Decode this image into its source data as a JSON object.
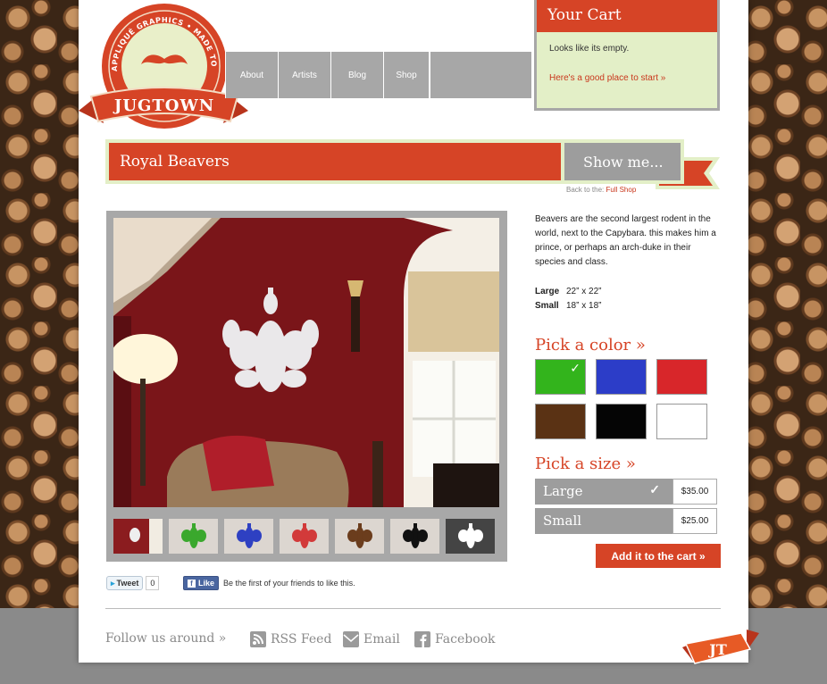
{
  "logo": {
    "arc_text": "VINYL APPLIQUÉ GRAPHICS • MADE TO ORDER",
    "brand": "JUGTOWN"
  },
  "nav": {
    "items": [
      "About",
      "Artists",
      "Blog",
      "Shop"
    ]
  },
  "cart": {
    "title": "Your Cart",
    "empty_text": "Looks like its empty.",
    "start_link": "Here's a good place to start »"
  },
  "product": {
    "title": "Royal Beavers",
    "show_me": "Show me...",
    "back_prefix": "Back to the:",
    "back_link": "Full Shop",
    "description": "Beavers are the second largest rodent in the world, next to the Capybara. this makes him a prince, or perhaps an arch-duke in their species and class.",
    "sizes": [
      {
        "label": "Large",
        "dims": "22” x 22”"
      },
      {
        "label": "Small",
        "dims": "18” x 18”"
      }
    ]
  },
  "thumbnails": {
    "colors": [
      "#ffffff",
      "#3aa82d",
      "#2e40c2",
      "#d23a3a",
      "#6b3d1d",
      "#111111",
      "#ffffff"
    ],
    "backgrounds": [
      "#8b1c1f",
      "#dcd6d0",
      "#dcd6d0",
      "#dcd6d0",
      "#dcd6d0",
      "#dcd6d0",
      "#444444"
    ]
  },
  "color_picker": {
    "heading": "Pick a color »",
    "swatches": [
      {
        "name": "green",
        "hex": "#33b41c",
        "selected": true
      },
      {
        "name": "blue",
        "hex": "#2c3dc8",
        "selected": false
      },
      {
        "name": "red",
        "hex": "#d8262a",
        "selected": false
      },
      {
        "name": "brown",
        "hex": "#5a3214",
        "selected": false
      },
      {
        "name": "black",
        "hex": "#050505",
        "selected": false
      },
      {
        "name": "white",
        "hex": "#ffffff",
        "selected": false
      }
    ]
  },
  "size_picker": {
    "heading": "Pick a size »",
    "options": [
      {
        "label": "Large",
        "price": "$35.00",
        "selected": true
      },
      {
        "label": "Small",
        "price": "$25.00",
        "selected": false
      }
    ]
  },
  "add_to_cart": "Add it to the cart »",
  "social": {
    "tweet_label": "Tweet",
    "tweet_count": "0",
    "like_label": "Like",
    "like_text": "Be the first of your friends to like this."
  },
  "footer": {
    "follow": "Follow us around »",
    "links": [
      "RSS Feed",
      "Email",
      "Facebook"
    ],
    "badge": "JT"
  },
  "colors": {
    "accent_red": "#d64426",
    "panel_green": "#e3efc7",
    "neutral_gray": "#9d9d9d"
  }
}
